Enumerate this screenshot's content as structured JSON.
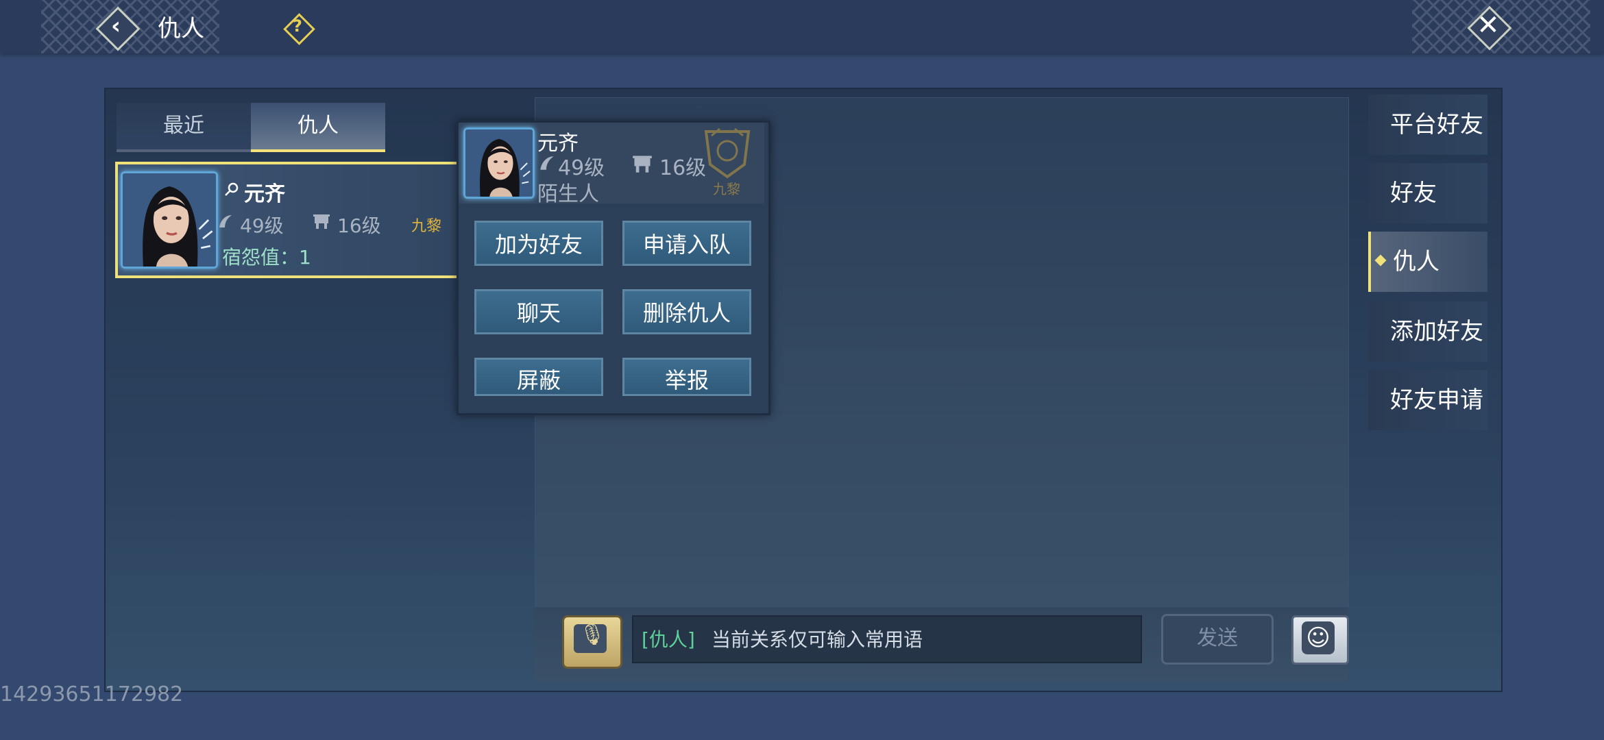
{
  "header": {
    "title": "仇人",
    "help_symbol": "?",
    "back_symbol": "‹",
    "close_symbol": "✕"
  },
  "list_tabs": [
    {
      "label": "最近",
      "active": false
    },
    {
      "label": "仇人",
      "active": true
    }
  ],
  "enemy_list": [
    {
      "name": "元齐",
      "level": "49级",
      "guild_level": "16级",
      "server": "九黎",
      "hate_label": "宿怨值：1"
    }
  ],
  "popup": {
    "name": "元齐",
    "level": "49级",
    "guild_level": "16级",
    "relation": "陌生人",
    "emblem_text": "九黎",
    "buttons": {
      "add_friend": "加为好友",
      "join_team": "申请入队",
      "chat": "聊天",
      "delete_enemy": "删除仇人",
      "block": "屏蔽",
      "report": "举报"
    }
  },
  "chat": {
    "tag": "[仇人]",
    "placeholder": "当前关系仅可输入常用语",
    "send_label": "发送",
    "mic_symbol": "🎙",
    "emoji_symbol": "☺"
  },
  "side_tabs": [
    {
      "label": "平台好友",
      "active": false
    },
    {
      "label": "好友",
      "active": false
    },
    {
      "label": "仇人",
      "active": true
    },
    {
      "label": "添加好友",
      "active": false
    },
    {
      "label": "好友申请",
      "active": false
    }
  ],
  "footer_id": "14293651172982",
  "colors": {
    "accent_yellow": "#efe27a",
    "hate_text": "#9fe0c8",
    "server_gold": "#e2b43d",
    "chat_tag_green": "#5fd19a"
  },
  "icons": {
    "back": "back-arrow-icon",
    "help": "help-icon",
    "close": "close-icon",
    "search": "search-icon",
    "level": "level-icon",
    "guild": "guild-icon",
    "mic": "microphone-icon",
    "emoji": "emoji-icon"
  }
}
